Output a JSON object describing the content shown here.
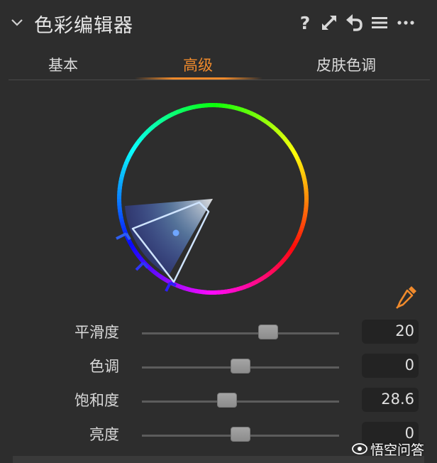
{
  "header": {
    "title": "色彩编辑器",
    "help_label": "?"
  },
  "tabs": [
    {
      "label": "基本",
      "active": false
    },
    {
      "label": "高级",
      "active": true
    },
    {
      "label": "皮肤色调",
      "active": false
    }
  ],
  "accent_color": "#f08a2c",
  "sliders": [
    {
      "label": "平滑度",
      "value": "20",
      "position": 0.64
    },
    {
      "label": "色调",
      "value": "0",
      "position": 0.5
    },
    {
      "label": "饱和度",
      "value": "28.6",
      "position": 0.43
    },
    {
      "label": "亮度",
      "value": "0",
      "position": 0.5
    }
  ],
  "icons": {
    "collapse": "chevron-down-icon",
    "help": "help-icon",
    "expand": "expand-icon",
    "reset": "reset-icon",
    "menu": "menu-icon",
    "more": "more-icon",
    "picker": "eyedropper-icon"
  },
  "watermark": {
    "text": "悟空问答"
  }
}
